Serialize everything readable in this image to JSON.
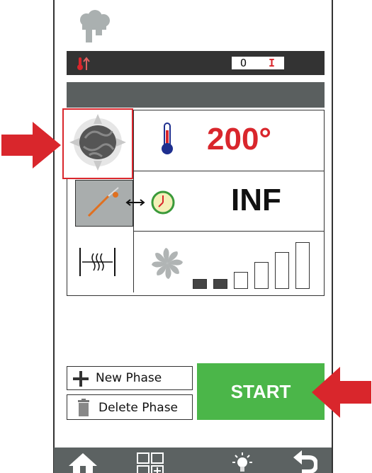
{
  "header": {
    "logo_icon": "chef-hat-icon",
    "status_icon": "temperature-up-icon",
    "toggle": {
      "off_label": "O",
      "on_label": "I"
    }
  },
  "settings": {
    "temperature": {
      "icon": "thermometer-icon",
      "value": "200°",
      "color": "#d9262c"
    },
    "time": {
      "icon": "timer-icon",
      "value": "INF",
      "color": "#111111"
    },
    "fan": {
      "icon": "fan-icon",
      "level": 2,
      "max_level": 6
    },
    "mode_icon": "convection-steam-icon",
    "probe_icon": "core-probe-icon",
    "humidity_icon": "humidity-damper-icon"
  },
  "actions": {
    "new_phase": "New Phase",
    "delete_phase": "Delete Phase",
    "start": "START"
  },
  "bottom_nav": [
    {
      "icon": "home-icon"
    },
    {
      "icon": "programs-grid-icon"
    },
    {
      "icon": "light-bulb-icon"
    },
    {
      "icon": "back-arrow-icon"
    }
  ],
  "annotation_color": "#d9262c"
}
